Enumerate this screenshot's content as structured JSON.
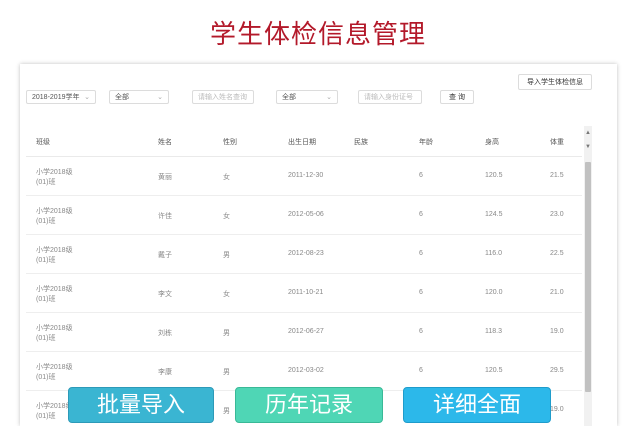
{
  "title": "学生体检信息管理",
  "toolbar": {
    "year_value": "2018-2019学年",
    "grade_value": "全部",
    "name_placeholder": "请输入姓名查询",
    "class_value": "全部",
    "id_placeholder": "请输入身份证号",
    "query_label": "查 询",
    "import_label": "导入学生体检信息"
  },
  "table": {
    "headers": [
      "班级",
      "姓名",
      "性别",
      "出生日期",
      "民族",
      "年龄",
      "身高",
      "体重"
    ],
    "rows": [
      {
        "class_line1": "小学2018级",
        "class_line2": "(01)班",
        "name": "黄丽",
        "gender": "女",
        "birth": "2011-12-30",
        "ethnic": "",
        "age": "6",
        "height": "120.5",
        "weight": "21.5"
      },
      {
        "class_line1": "小学2018级",
        "class_line2": "(01)班",
        "name": "许佳",
        "gender": "女",
        "birth": "2012-05-06",
        "ethnic": "",
        "age": "6",
        "height": "124.5",
        "weight": "23.0"
      },
      {
        "class_line1": "小学2018级",
        "class_line2": "(01)班",
        "name": "戴子",
        "gender": "男",
        "birth": "2012-08-23",
        "ethnic": "",
        "age": "6",
        "height": "116.0",
        "weight": "22.5"
      },
      {
        "class_line1": "小学2018级",
        "class_line2": "(01)班",
        "name": "李文",
        "gender": "女",
        "birth": "2011-10-21",
        "ethnic": "",
        "age": "6",
        "height": "120.0",
        "weight": "21.0"
      },
      {
        "class_line1": "小学2018级",
        "class_line2": "(01)班",
        "name": "刘栋",
        "gender": "男",
        "birth": "2012-06-27",
        "ethnic": "",
        "age": "6",
        "height": "118.3",
        "weight": "19.0"
      },
      {
        "class_line1": "小学2018级",
        "class_line2": "(01)班",
        "name": "李康",
        "gender": "男",
        "birth": "2012-03-02",
        "ethnic": "",
        "age": "6",
        "height": "120.5",
        "weight": "29.5"
      },
      {
        "class_line1": "小学2018级",
        "class_line2": "(01)班",
        "name": "",
        "gender": "男",
        "birth": "",
        "ethnic": "",
        "age": "",
        "height": "",
        "weight": "19.0"
      }
    ]
  },
  "overlay_buttons": {
    "batch_import": "批量导入",
    "history": "历年记录",
    "details": "详细全面"
  },
  "colors": {
    "title": "#b3192a",
    "batch_import": "#3ab5d2",
    "history": "#4fd6b5",
    "details": "#2cb8ea"
  }
}
